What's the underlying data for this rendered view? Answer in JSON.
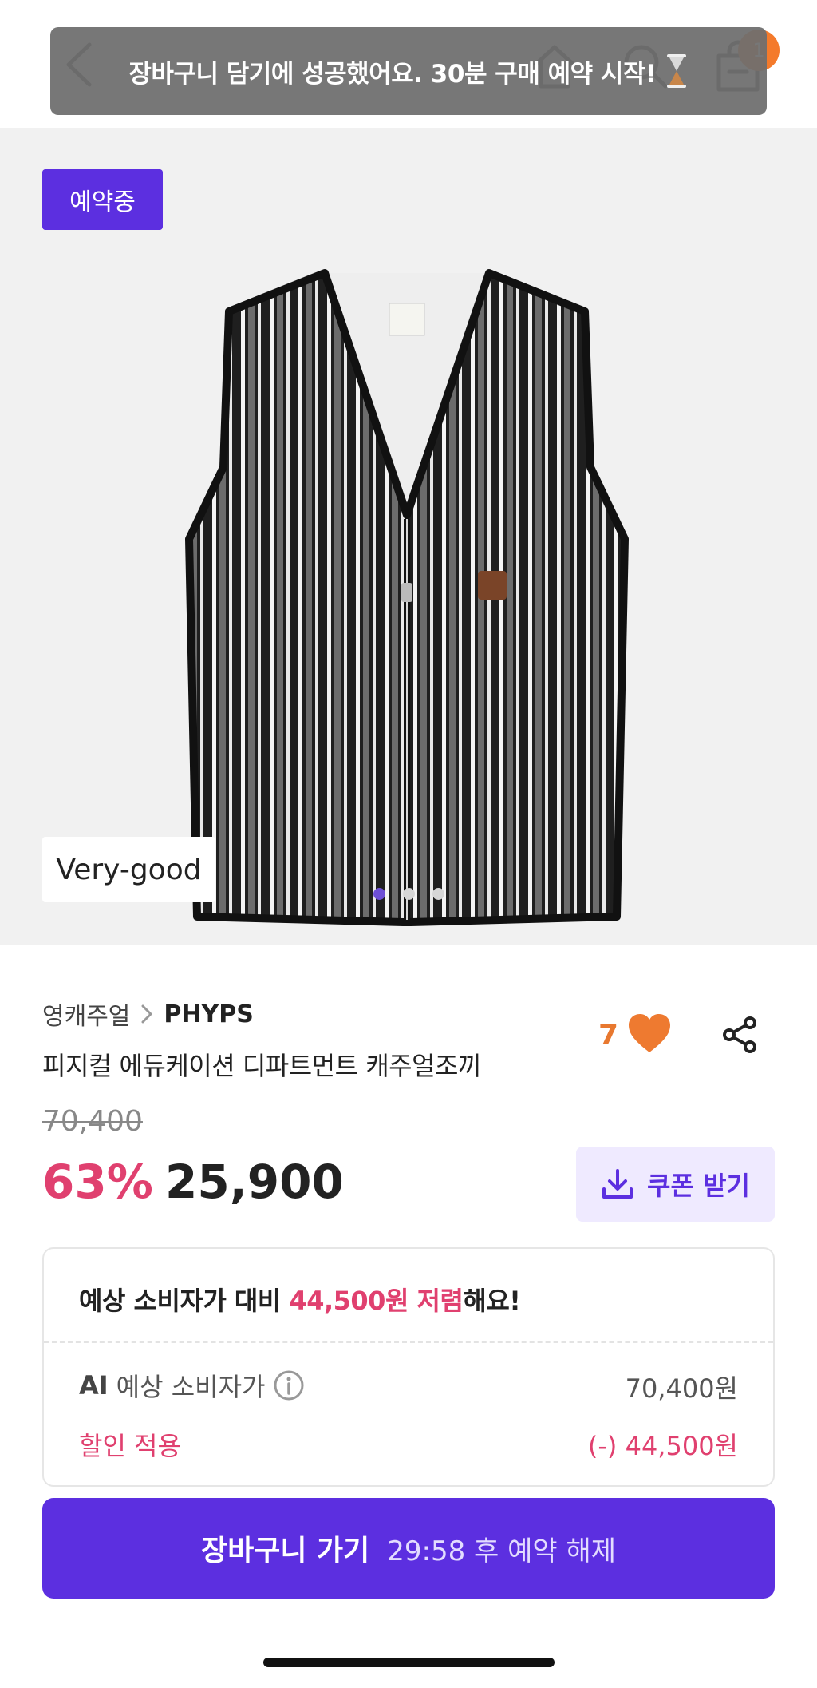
{
  "toast": {
    "message": "장바구니 담기에 성공했어요. 30분 구매 예약 시작!"
  },
  "nav": {
    "cart_count": "1"
  },
  "hero": {
    "status_badge": "예약중",
    "condition": "Very-good",
    "image_count": 3,
    "active_index": 0
  },
  "product": {
    "category": "영캐주얼",
    "brand": "PHYPS",
    "name": "피지컬 에듀케이션 디파트먼트 캐주얼조끼",
    "like_count": "7",
    "original_price": "70,400",
    "discount_rate": "63%",
    "sale_price": "25,900"
  },
  "coupon": {
    "label": "쿠폰 받기"
  },
  "savings": {
    "prefix": "예상 소비자가 대비 ",
    "highlight": "44,500원 저렴",
    "suffix": "해요!",
    "rows": [
      {
        "ai_tag": "AI",
        "label": "예상 소비자가",
        "value": "70,400원"
      },
      {
        "label": "할인 적용",
        "value": "(-) 44,500원"
      }
    ]
  },
  "cta": {
    "label": "장바구니 가기",
    "timer": "29:58 후 예약 해제"
  },
  "colors": {
    "brand": "#5c2fe0",
    "sale": "#e0406f",
    "like": "#e8782f"
  }
}
